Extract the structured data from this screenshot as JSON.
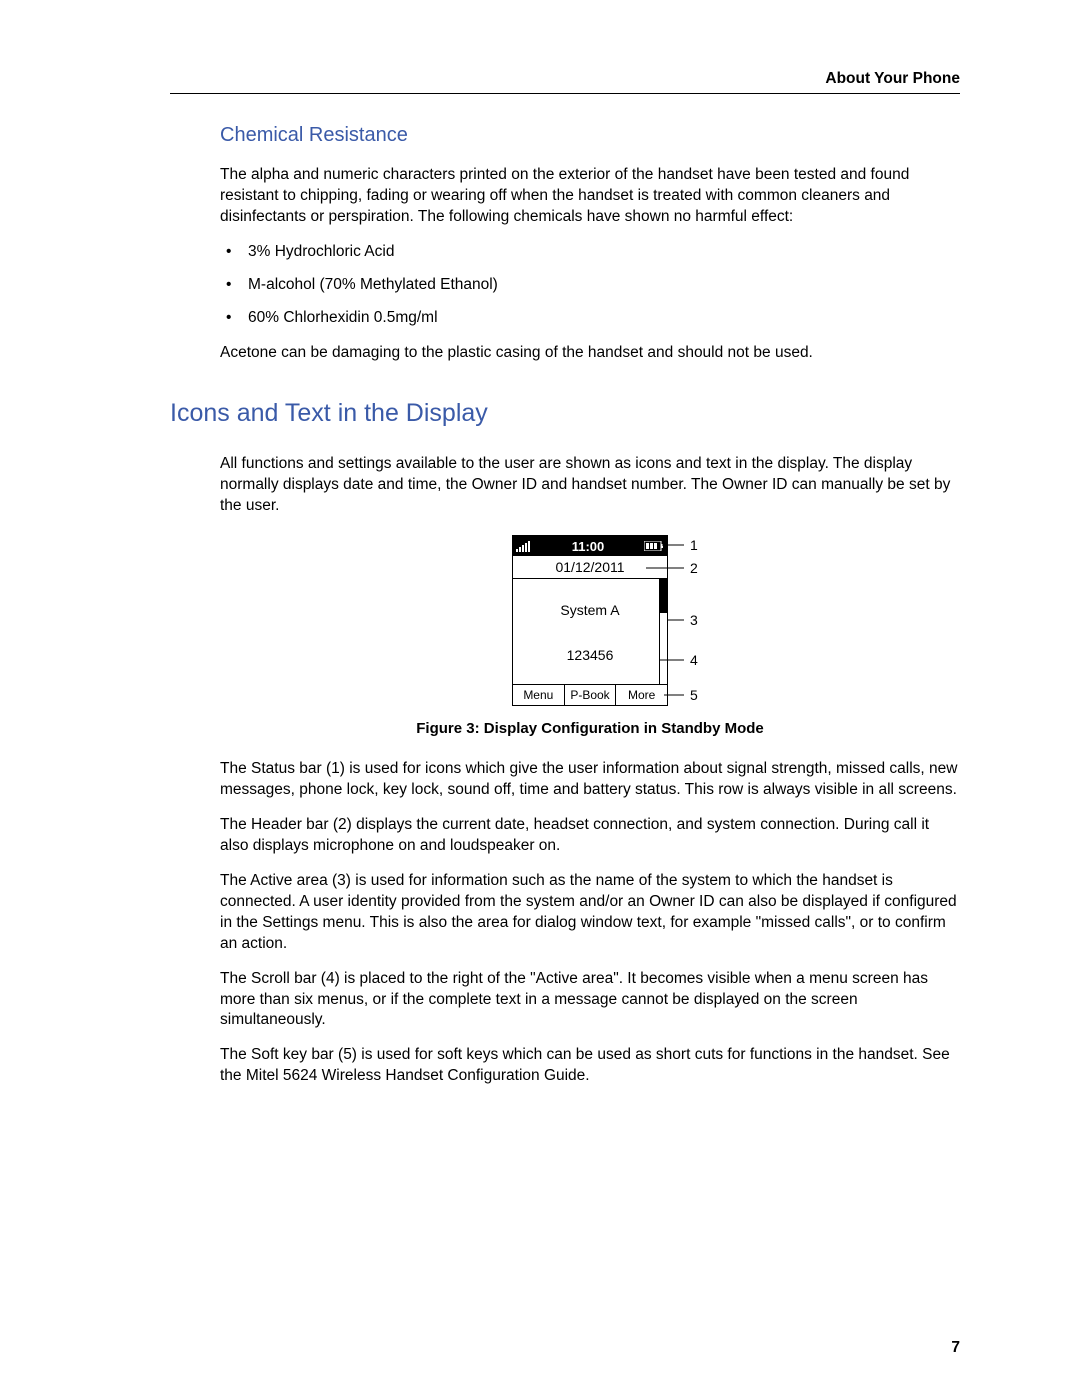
{
  "header": {
    "running_head": "About Your Phone"
  },
  "chemical": {
    "heading": "Chemical Resistance",
    "intro": "The alpha and numeric characters printed on the exterior of the handset have been tested and found resistant to chipping, fading or wearing off when the handset is treated with common cleaners and disinfectants or perspiration. The following chemicals have shown no harmful effect:",
    "bullets": [
      "3% Hydrochloric Acid",
      "M-alcohol (70% Methylated Ethanol)",
      "60% Chlorhexidin 0.5mg/ml"
    ],
    "acetone": "Acetone can be damaging to the plastic casing of the handset and should not be used."
  },
  "icons_section": {
    "heading": "Icons and Text in the Display",
    "intro": "All functions and settings available to the user are shown as icons and text in the display. The display normally displays date and time, the Owner ID and handset number. The Owner ID can manually be set by the user.",
    "paragraphs": [
      "The Status bar (1) is used for icons which give the user information about signal strength, missed calls, new messages, phone lock, key lock, sound off, time and battery status. This row is always visible in all screens.",
      "The Header bar (2) displays the current date, headset connection, and system connection. During call it also displays microphone on and loudspeaker on.",
      "The Active area (3) is used for information such as the name of the system to which the handset is connected. A user identity provided from the system and/or an Owner ID can also be displayed if configured in the Settings menu. This is also the area for dialog window text, for example \"missed calls\", or to confirm an action.",
      "The Scroll bar (4) is placed to the right of the \"Active area\". It becomes visible when a menu screen has more than six menus, or if the complete text in a message cannot be displayed on the screen simultaneously.",
      "The Soft key bar (5) is used for soft keys which can be used as short cuts for functions in the handset. See the Mitel 5624 Wireless Handset Configuration Guide."
    ]
  },
  "figure": {
    "caption": "Figure 3: Display Configuration in Standby Mode",
    "display": {
      "time": "11:00",
      "date": "01/12/2011",
      "system": "System A",
      "number": "123456",
      "softkeys": [
        "Menu",
        "P-Book",
        "More"
      ]
    },
    "callouts": [
      "1",
      "2",
      "3",
      "4",
      "5"
    ]
  },
  "page_number": "7"
}
